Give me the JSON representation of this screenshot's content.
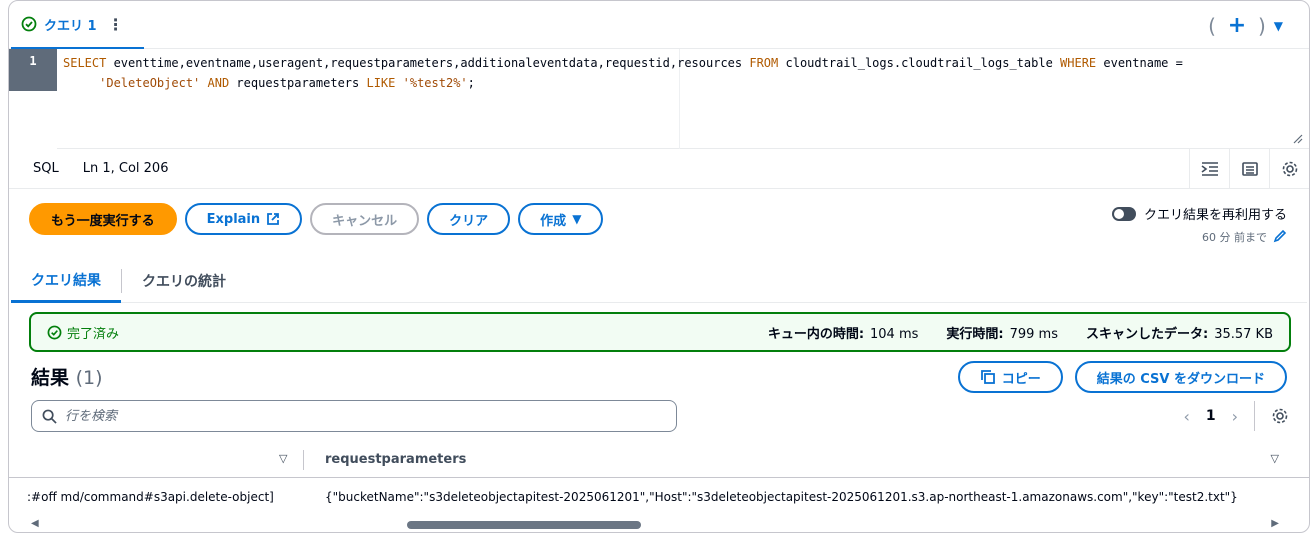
{
  "tab": {
    "label": "クエリ 1",
    "menu_glyph": "⋮"
  },
  "tab_actions": {
    "open_paren": "(",
    "plus": "+",
    "close_paren": ")",
    "dropdown": "▼"
  },
  "editor": {
    "line_number": "1",
    "line1": {
      "k1": "SELECT",
      "cols": " eventtime,eventname,useragent,requestparameters,additionaleventdata,requestid,resources ",
      "k2": "FROM",
      "table": " cloudtrail_logs.cloudtrail_logs_table ",
      "k3": "WHERE",
      "cond": " eventname ="
    },
    "line2": {
      "indent": "     ",
      "s1": "'DeleteObject'",
      "sp1": " ",
      "k4": "AND",
      "mid": " requestparameters ",
      "k5": "LIKE",
      "sp2": " ",
      "s2": "'%test2%'",
      "end": ";"
    }
  },
  "status": {
    "language": "SQL",
    "position": "Ln 1, Col 206"
  },
  "buttons": {
    "run_again": "もう一度実行する",
    "explain": "Explain",
    "cancel": "キャンセル",
    "clear": "クリア",
    "create": "作成"
  },
  "reuse": {
    "label": "クエリ結果を再利用する",
    "ago": "60 分 前まで"
  },
  "result_tabs": {
    "results": "クエリ結果",
    "stats": "クエリの統計"
  },
  "completed": {
    "status": "完了済み",
    "queue_label": "キュー内の時間:",
    "queue_value": "104 ms",
    "exec_label": "実行時間:",
    "exec_value": "799 ms",
    "scan_label": "スキャンしたデータ:",
    "scan_value": "35.57 KB"
  },
  "results": {
    "title": "結果",
    "count": "(1)",
    "copy_label": "コピー",
    "download_label": "結果の CSV をダウンロード",
    "search_placeholder": "行を検索",
    "page": "1"
  },
  "table": {
    "column2": "requestparameters",
    "row1_col1": ":#off md/command#s3api.delete-object]",
    "row1_col2": "{\"bucketName\":\"s3deleteobjectapitest-2025061201\",\"Host\":\"s3deleteobjectapitest-2025061201.s3.ap-northeast-1.amazonaws.com\",\"key\":\"test2.txt\"}"
  },
  "colors": {
    "accent": "#0972d3",
    "primary_button": "#ff9900",
    "success": "#037f0c"
  }
}
